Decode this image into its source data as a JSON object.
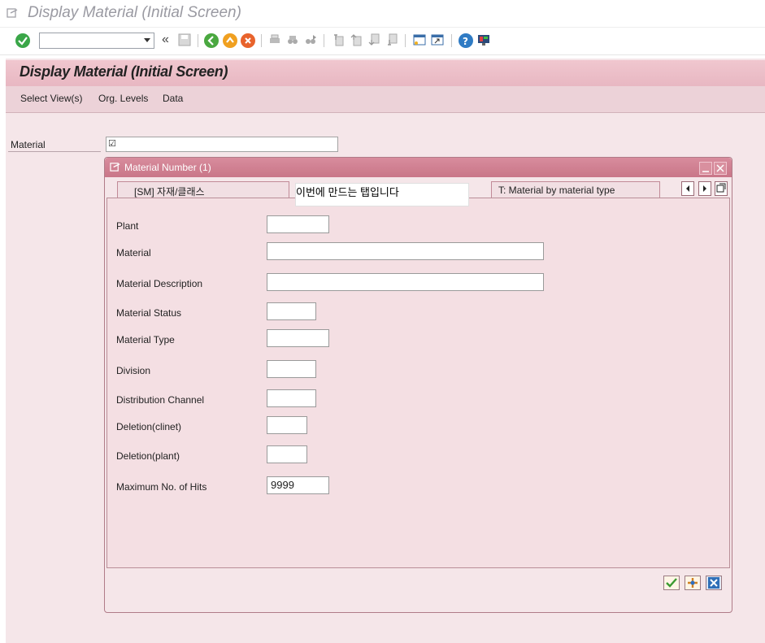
{
  "window": {
    "title": "Display Material (Initial Screen)"
  },
  "toolbar": {
    "command_field_value": "",
    "icons": [
      "enter-icon",
      "back-double-icon",
      "save-icon",
      "back-icon",
      "exit-icon",
      "cancel-icon",
      "print-icon",
      "find-icon",
      "find-next-icon",
      "first-page-icon",
      "previous-page-icon",
      "next-page-icon",
      "last-page-icon",
      "create-session-icon",
      "shortcut-icon",
      "help-icon",
      "customize-layout-icon"
    ],
    "collapse_glyph": "«"
  },
  "screen": {
    "title": "Display Material (Initial Screen)",
    "menu": [
      "Select View(s)",
      "Org. Levels",
      "Data"
    ]
  },
  "material_field": {
    "label": "Material",
    "value": ""
  },
  "dialog": {
    "title": "Material Number (1)",
    "tabs": [
      {
        "label": "[SM] 자재/클래스",
        "active": false
      },
      {
        "label": "이번에 만드는 탭입니다",
        "active": true
      },
      {
        "label": "T: Material by material type",
        "active": false
      }
    ],
    "fields": [
      {
        "label": "Plant",
        "value": ""
      },
      {
        "label": "Material",
        "value": ""
      },
      {
        "label": "Material Description",
        "value": ""
      },
      {
        "label": "Material Status",
        "value": ""
      },
      {
        "label": "Material Type",
        "value": ""
      },
      {
        "label": "Division",
        "value": ""
      },
      {
        "label": "Distribution Channel",
        "value": ""
      },
      {
        "label": "Deletion(clinet)",
        "value": ""
      },
      {
        "label": "Deletion(plant)",
        "value": ""
      },
      {
        "label": "Maximum No. of Hits",
        "value": "9999"
      }
    ],
    "buttons": [
      "continue-icon",
      "multiple-selection-icon",
      "cancel-icon"
    ]
  },
  "colors": {
    "title_bar_text": "#9a9aa2",
    "screen_header": "#eebfc9",
    "dialog_title": "#cf8092",
    "background": "#f5e6e9"
  }
}
